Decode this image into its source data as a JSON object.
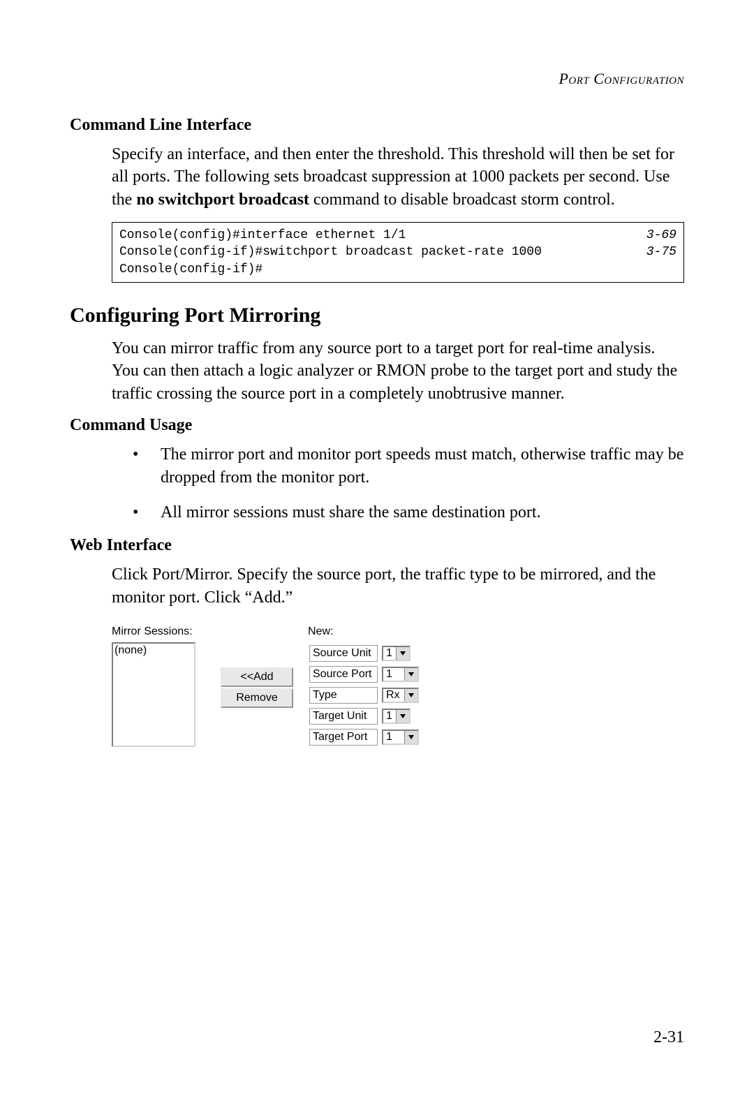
{
  "running_head": "Port Configuration",
  "cli_heading": "Command Line Interface",
  "cli_para_pre": "Specify an interface, and then enter the threshold. This threshold will then be set for all ports. The following sets broadcast suppression at 1000 packets per second. Use the ",
  "cli_para_bold": "no switchport broadcast",
  "cli_para_post": " command to disable broadcast storm control.",
  "code": {
    "l1_cmd": "Console(config)#interface ethernet 1/1",
    "l1_ref": "3-69",
    "l2_cmd": "Console(config-if)#switchport broadcast packet-rate 1000",
    "l2_ref": "3-75",
    "l3_cmd": "Console(config-if)#"
  },
  "mirror_heading": "Configuring Port Mirroring",
  "mirror_para": "You can mirror traffic from any source port to a target port for real-time analysis. You can then attach a logic analyzer or RMON probe to the target port and study the traffic crossing the source port in a completely unobtrusive manner.",
  "usage_heading": "Command Usage",
  "bullets": {
    "b1": "The mirror port and monitor port speeds must match, otherwise traffic may be dropped from the monitor port.",
    "b2": "All mirror sessions must share the same destination port."
  },
  "web_heading": "Web Interface",
  "web_para": "Click Port/Mirror. Specify the source port, the traffic type to be mirrored, and the monitor port. Click “Add.”",
  "ui": {
    "sessions_label": "Mirror Sessions:",
    "sessions_value": "(none)",
    "new_label": "New:",
    "add_btn": "<<Add",
    "remove_btn": "Remove",
    "fields": {
      "source_unit": {
        "label": "Source Unit",
        "value": "1"
      },
      "source_port": {
        "label": "Source Port",
        "value": "1"
      },
      "type": {
        "label": "Type",
        "value": "Rx"
      },
      "target_unit": {
        "label": "Target Unit",
        "value": "1"
      },
      "target_port": {
        "label": "Target Port",
        "value": "1"
      }
    }
  },
  "page_number": "2-31"
}
